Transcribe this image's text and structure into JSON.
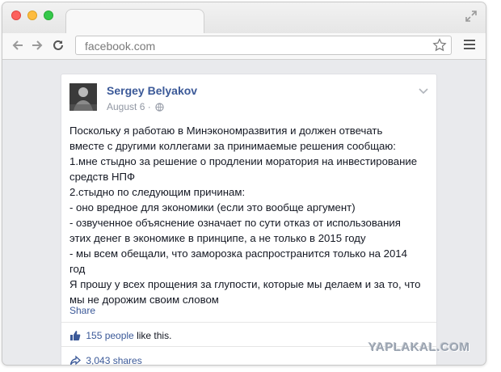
{
  "browser": {
    "url": "facebook.com"
  },
  "post": {
    "author": "Sergey Belyakov",
    "date": "August 6",
    "separator": "·",
    "lines": [
      "Поскольку я работаю в Минэкономразвития и должен отвечать",
      "вместе с другими коллегами за принимаемые решения сообщаю:",
      "1.мне стыдно за решение о продлении моратория на инвестирование",
      "средств НПФ",
      "2.стыдно по следующим причинам:",
      "- оно вредное для экономики (если это вообще аргумент)",
      "- озвученное объяснение означает по сути отказ от использования",
      "этих денег в экономике в принципе, а не только в 2015 году",
      "- мы всем обещали, что заморозка распространится только на 2014",
      "год",
      "Я прошу у всех прощения за глупости, которые мы делаем и за то, что",
      "мы не дорожим своим словом"
    ],
    "share_label": "Share",
    "likes_count": "155 people",
    "likes_suffix": "like this.",
    "shares_count": "3,043 shares"
  },
  "watermark": "YAPLAKAL.COM",
  "icons": [
    "back-arrow-icon",
    "forward-arrow-icon",
    "reload-icon",
    "star-icon",
    "menu-icon",
    "expand-icon",
    "globe-icon",
    "chevron-down-icon",
    "thumbs-up-icon",
    "share-arrow-icon"
  ],
  "colors": {
    "link": "#3b5998",
    "text": "#141823",
    "meta": "#9197a3",
    "page_background": "#e9eaed"
  }
}
